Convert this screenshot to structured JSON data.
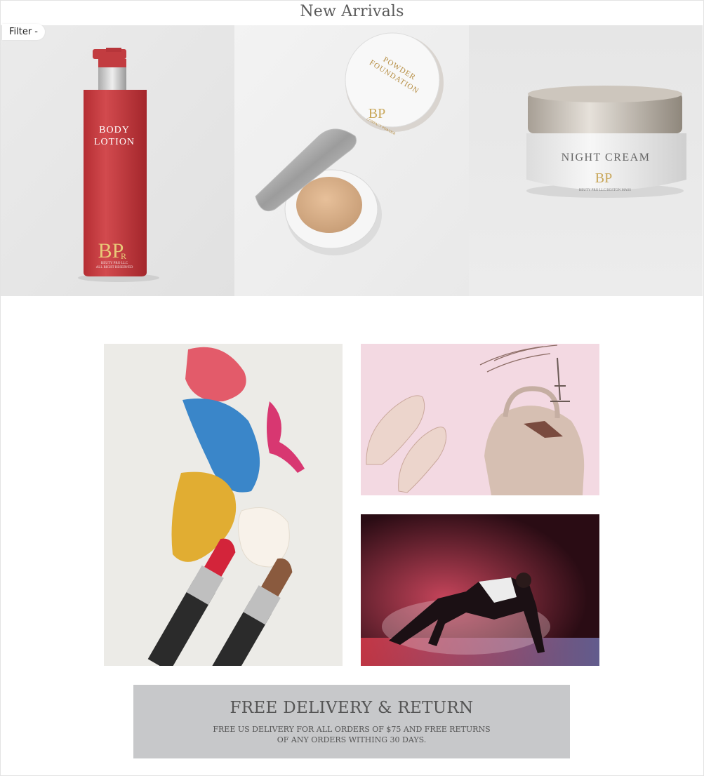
{
  "page": {
    "title": "New Arrivals"
  },
  "filter": {
    "label": "Filter",
    "indicator": "-"
  },
  "products": [
    {
      "label_line1": "BODY",
      "label_line2": "LOTION",
      "logo": "BP",
      "logo_sub": "R",
      "small_line1": "BEUTY PRO LLC",
      "small_line2": "ALL RIGHT RESERVED"
    },
    {
      "lid_line1": "POWDER",
      "lid_line2": "FOUNDATION",
      "logo": "BP",
      "small": "COMPACT POWDER"
    },
    {
      "label": "NIGHT CREAM",
      "logo": "BP",
      "small": "BEUTY PRO LLC BOSTON MASS"
    }
  ],
  "promo_images": [
    {
      "subject": "cosmetics-lipstick-powder"
    },
    {
      "subject": "shoes-and-handbag"
    },
    {
      "subject": "fitness-runner"
    }
  ],
  "delivery": {
    "title": "FREE DELIVERY & RETURN",
    "line1": "FREE US DELIVERY FOR ALL ORDERS OF $75 AND FREE RETURNS",
    "line2": "OF ANY ORDERS WITHING 30 DAYS."
  },
  "colors": {
    "banner_bg": "#c7c8ca",
    "lotion_red": "#c43a3e",
    "gold": "#c9a75a"
  }
}
